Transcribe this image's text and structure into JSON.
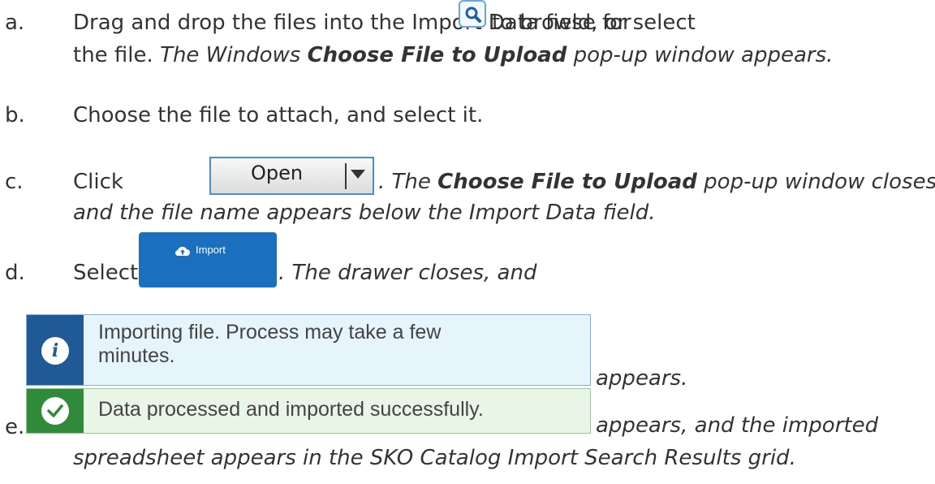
{
  "steps": {
    "a": {
      "letter": "a.",
      "text1": "Drag and drop the files into the Import Data field, or select",
      "text2": "to browse for",
      "line2_plain": "the file.",
      "line2_italic": "The Windows",
      "line2_bold": "Choose File to Upload",
      "line2_italic_end": "pop-up window appears.",
      "icon": "search-icon"
    },
    "b": {
      "letter": "b.",
      "text": "Choose the file to attach, and select it."
    },
    "c": {
      "letter": "c.",
      "prefix": "Click",
      "button_label": "Open",
      "after_italic": ". The",
      "after_bold": "Choose File to Upload",
      "after_italic_end": "pop-up window closes,",
      "line2": "and the file name appears below the Import Data field."
    },
    "d": {
      "letter": "d.",
      "prefix": "Select",
      "button_label": "Import",
      "button_icon": "cloud-upload-icon",
      "after": ". The drawer closes, and",
      "toast_message": "Importing file. Process may take a few minutes.",
      "toast_icon": "info-icon",
      "suffix": "appears."
    },
    "e": {
      "letter": "e.",
      "toast_message": "Data processed and imported successfully.",
      "toast_icon": "checkmark-icon",
      "suffix": "appears, and the imported",
      "line2": "spreadsheet appears in the SKO Catalog Import Search Results grid."
    }
  },
  "colors": {
    "import_button": "#1a6fbf",
    "info_accent": "#1f5a96",
    "info_bg": "#e6f4fb",
    "success_accent": "#2f8a3a",
    "success_bg": "#e9f5e6"
  }
}
